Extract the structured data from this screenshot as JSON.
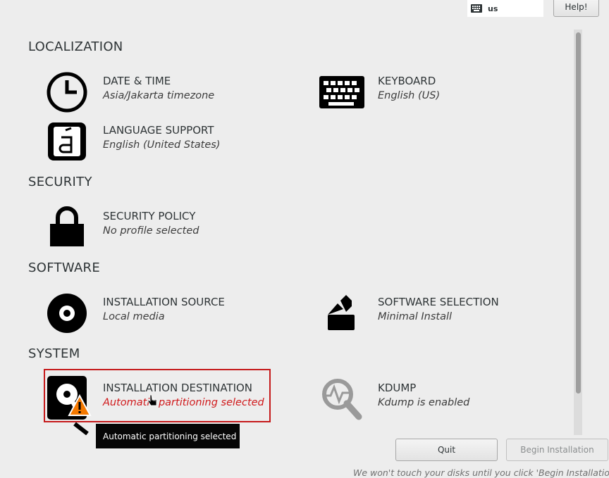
{
  "header": {
    "keyboard_layout": "us",
    "help_label": "Help!"
  },
  "sections": {
    "localization": "LOCALIZATION",
    "security": "SECURITY",
    "software": "SOFTWARE",
    "system": "SYSTEM"
  },
  "spokes": {
    "date_time": {
      "title": "DATE & TIME",
      "status": "Asia/Jakarta timezone",
      "icon": "clock-icon"
    },
    "keyboard": {
      "title": "KEYBOARD",
      "status": "English (US)",
      "icon": "keyboard-icon"
    },
    "language": {
      "title": "LANGUAGE SUPPORT",
      "status": "English (United States)",
      "icon": "language-icon"
    },
    "security_policy": {
      "title": "SECURITY POLICY",
      "status": "No profile selected",
      "icon": "lock-icon"
    },
    "install_source": {
      "title": "INSTALLATION SOURCE",
      "status": "Local media",
      "icon": "disc-icon"
    },
    "software_selection": {
      "title": "SOFTWARE SELECTION",
      "status": "Minimal Install",
      "icon": "package-icon"
    },
    "install_destination": {
      "title": "INSTALLATION DESTINATION",
      "status": "Automatic partitioning selected",
      "icon": "hard-disk-icon"
    },
    "kdump": {
      "title": "KDUMP",
      "status": "Kdump is enabled",
      "icon": "kdump-magnifier-icon"
    }
  },
  "tooltip": {
    "text": "Automatic partitioning selected"
  },
  "footer": {
    "quit_label": "Quit",
    "begin_label": "Begin Installation",
    "note": "We won't touch your disks until you click 'Begin Installation'."
  },
  "colors": {
    "warning": "#d0191b",
    "highlight_border": "#c5191a",
    "warning_triangle": "#f57900"
  }
}
